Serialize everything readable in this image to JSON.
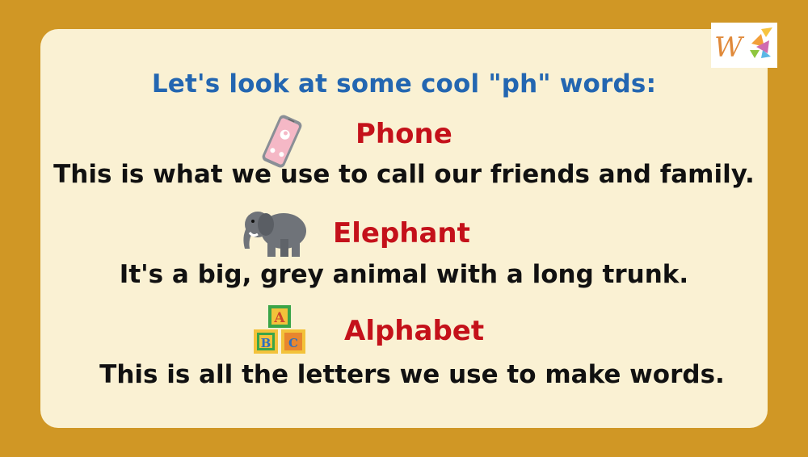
{
  "heading": "Let's look at some cool \"ph\" words:",
  "items": [
    {
      "word": "Phone",
      "description": "This is what we use to call our friends and family.",
      "icon": "phone-icon"
    },
    {
      "word": "Elephant",
      "description": "It's a big, grey animal with a long trunk.",
      "icon": "elephant-icon"
    },
    {
      "word": "Alphabet",
      "description": "This is all the letters we use to make words.",
      "icon": "alphabet-blocks-icon"
    }
  ],
  "logo": {
    "letter": "W",
    "icon": "logo-icon"
  },
  "blocks": {
    "a": "A",
    "b": "B",
    "c": "C"
  },
  "colors": {
    "background": "#d09725",
    "card": "#faf1d3",
    "heading": "#2366b1",
    "word": "#c4111a",
    "text": "#111111"
  }
}
